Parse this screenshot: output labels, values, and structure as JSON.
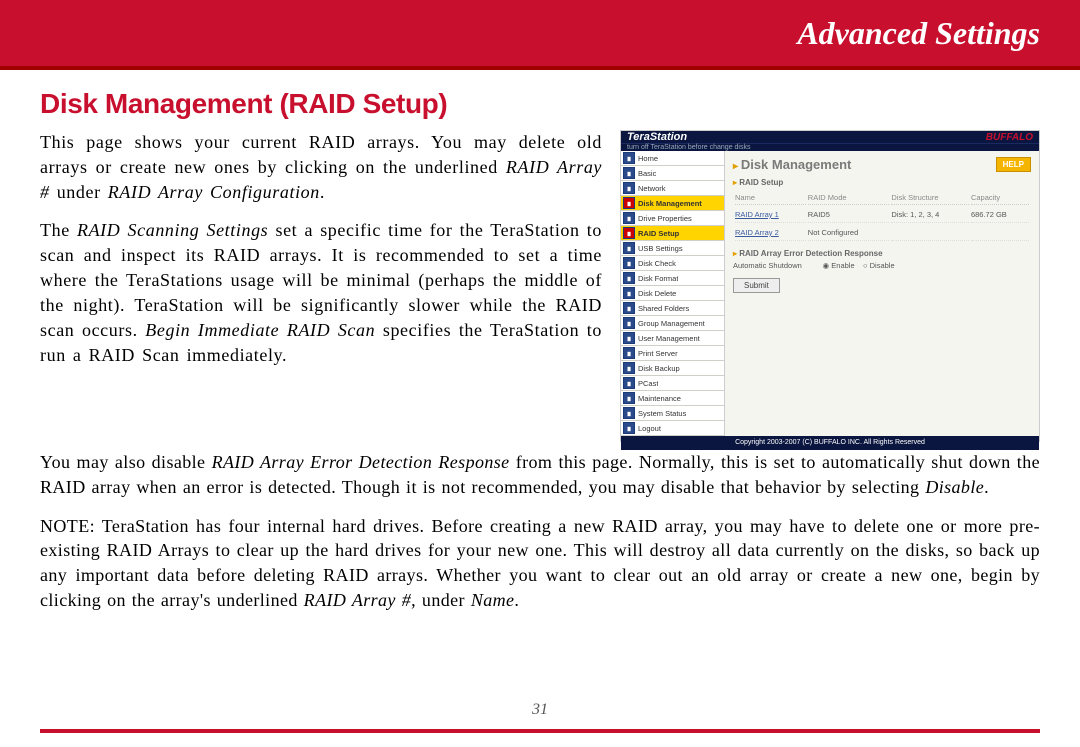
{
  "header": {
    "title": "Advanced Settings"
  },
  "section": {
    "heading": "Disk Management (RAID Setup)"
  },
  "para1": {
    "a": "This page shows your current RAID arrays.  You may delete old arrays or create new ones by clicking on the underlined ",
    "b": "RAID Array #",
    "c": " under ",
    "d": "RAID Array Configuration",
    "e": "."
  },
  "para2": {
    "a": "The ",
    "b": "RAID Scanning Settings",
    "c": " set a specific time for the TeraStation to scan and inspect its RAID arrays.  It is recommended to set a time where the TeraStations usage will be minimal (perhaps the middle of the night).  TeraStation will be significantly slower while the RAID scan occurs.  ",
    "d": "Begin Immediate RAID Scan",
    "e": " specifies the TeraStation to run a RAID Scan immediately."
  },
  "para3": {
    "a": "You may also disable ",
    "b": "RAID Array Error Detection Response",
    "c": " from this page.  Normally, this is set to automatically shut down the RAID array when an error is detected.  Though it is not recommended, you may disable that behavior by selecting ",
    "d": "Disable",
    "e": "."
  },
  "para4": {
    "a": "NOTE: TeraStation has four internal hard drives.  Before creating a new RAID array, you may have to delete one or more pre-existing RAID Arrays to clear up the hard drives for your new one.  This will destroy all data currently on the disks, so back up any important data before deleting RAID arrays.   Whether you want to clear out an old array or create a new one, begin by clicking on the array's underlined ",
    "b": "RAID Array #",
    "c": ", under ",
    "d": "Name",
    "e": "."
  },
  "page_number": "31",
  "screenshot": {
    "brand_left": "TeraStation",
    "brand_right": "BUFFALO",
    "sub": "turn off TeraStation before change disks",
    "nav": [
      "Home",
      "Basic",
      "Network",
      "Disk Management",
      "Drive Properties",
      "RAID Setup",
      "USB Settings",
      "Disk Check",
      "Disk Format",
      "Disk Delete",
      "Shared Folders",
      "Group Management",
      "User Management",
      "Print Server",
      "Disk Backup",
      "PCast",
      "Maintenance",
      "System Status",
      "Logout"
    ],
    "nav_selected": [
      3,
      5
    ],
    "main_title": "Disk Management",
    "help": "HELP",
    "panel1": "RAID Setup",
    "cols": [
      "Name",
      "RAID Mode",
      "Disk Structure",
      "Capacity"
    ],
    "rows": [
      {
        "name": "RAID Array 1",
        "mode": "RAID5",
        "disks": "Disk: 1, 2, 3, 4",
        "cap": "686.72 GB"
      },
      {
        "name": "RAID Array 2",
        "mode": "Not Configured",
        "disks": "",
        "cap": ""
      }
    ],
    "panel2": "RAID Array Error Detection Response",
    "panel2_row": {
      "label": "Automatic Shutdown",
      "opt1": "Enable",
      "opt2": "Disable"
    },
    "submit": "Submit",
    "footer": "Copyright 2003-2007 (C) BUFFALO INC. All Rights Reserved"
  }
}
